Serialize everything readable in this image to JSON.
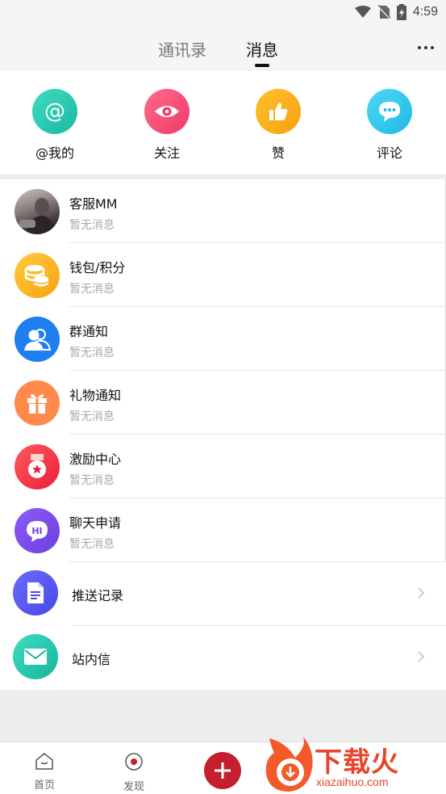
{
  "status_bar": {
    "time": "4:59"
  },
  "header": {
    "tabs": [
      {
        "label": "通讯录"
      },
      {
        "label": "消息"
      }
    ]
  },
  "quick_actions": [
    {
      "label": "@我的",
      "icon": "at-icon"
    },
    {
      "label": "关注",
      "icon": "eye-icon"
    },
    {
      "label": "赞",
      "icon": "thumbs-up-icon"
    },
    {
      "label": "评论",
      "icon": "comment-icon"
    }
  ],
  "messages": [
    {
      "title": "客服MM",
      "subtitle": "暂无消息",
      "icon": "service-avatar"
    },
    {
      "title": "钱包/积分",
      "subtitle": "暂无消息",
      "icon": "coins-icon"
    },
    {
      "title": "群通知",
      "subtitle": "暂无消息",
      "icon": "group-icon"
    },
    {
      "title": "礼物通知",
      "subtitle": "暂无消息",
      "icon": "gift-icon"
    },
    {
      "title": "激励中心",
      "subtitle": "暂无消息",
      "icon": "medal-icon"
    },
    {
      "title": "聊天申请",
      "subtitle": "暂无消息",
      "icon": "hi-chat-icon"
    }
  ],
  "links": [
    {
      "title": "推送记录",
      "icon": "document-icon"
    },
    {
      "title": "站内信",
      "icon": "envelope-icon"
    }
  ],
  "bottom_nav": [
    {
      "label": "首页",
      "icon": "home-icon"
    },
    {
      "label": "发现",
      "icon": "discover-icon"
    },
    {
      "label": "",
      "icon": "plus-icon"
    }
  ],
  "watermark": {
    "text": "下载火",
    "url": "xiazaihuo.com"
  }
}
